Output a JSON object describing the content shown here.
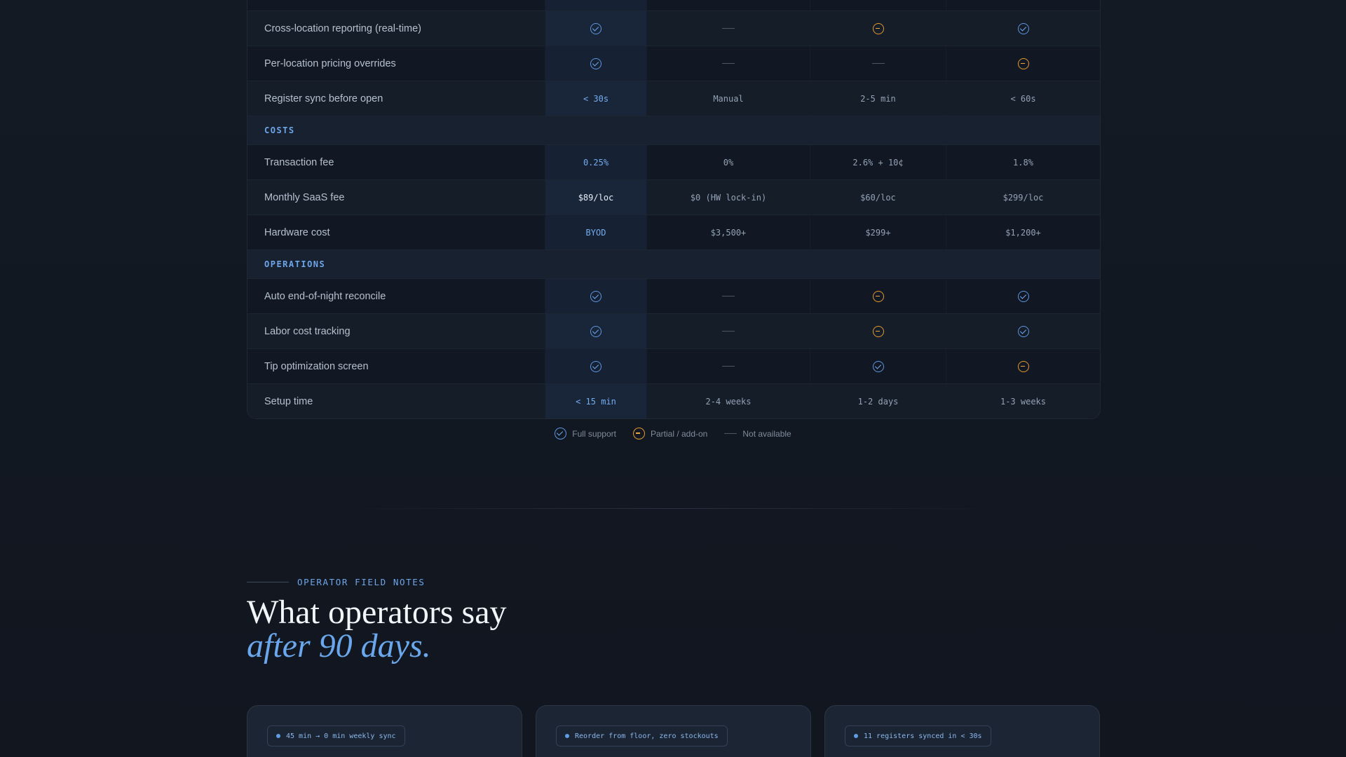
{
  "comparison": {
    "rows_top": [
      {
        "label": "Cross-location reporting (real-time)",
        "cells": [
          "check",
          "dash",
          "partial",
          "check"
        ]
      },
      {
        "label": "Per-location pricing overrides",
        "cells": [
          "check",
          "dash",
          "dash",
          "partial"
        ]
      },
      {
        "label": "Register sync before open",
        "cells": [
          "< 30s",
          "Manual",
          "2-5 min",
          "< 60s"
        ]
      }
    ],
    "sections": [
      {
        "title": "COSTS",
        "rows": [
          {
            "label": "Transaction fee",
            "cells": [
              "0.25%",
              "0%",
              "2.6% + 10¢",
              "1.8%"
            ]
          },
          {
            "label": "Monthly SaaS fee",
            "cells": [
              "$89/loc",
              "$0 (HW lock-in)",
              "$60/loc",
              "$299/loc"
            ]
          },
          {
            "label": "Hardware cost",
            "cells": [
              "BYOD",
              "$3,500+",
              "$299+",
              "$1,200+"
            ]
          }
        ]
      },
      {
        "title": "OPERATIONS",
        "rows": [
          {
            "label": "Auto end-of-night reconcile",
            "cells": [
              "check",
              "dash",
              "partial",
              "check"
            ]
          },
          {
            "label": "Labor cost tracking",
            "cells": [
              "check",
              "dash",
              "partial",
              "check"
            ]
          },
          {
            "label": "Tip optimization screen",
            "cells": [
              "check",
              "dash",
              "check",
              "partial"
            ]
          },
          {
            "label": "Setup time",
            "cells": [
              "< 15 min",
              "2-4 weeks",
              "1-2 days",
              "1-3 weeks"
            ]
          }
        ]
      }
    ]
  },
  "legend": {
    "full": "Full support",
    "partial": "Partial / add-on",
    "none": "Not available"
  },
  "field_notes": {
    "eyebrow": "OPERATOR FIELD NOTES",
    "headline_line1": "What operators say",
    "headline_line2": "after 90 days."
  },
  "cards": [
    {
      "tag": "45 min → 0 min weekly sync"
    },
    {
      "tag": "Reorder from floor, zero stockouts"
    },
    {
      "tag": "11 registers synced in < 30s"
    }
  ],
  "colors": {
    "accent": "#6ea6ea",
    "partial": "#e39a2f",
    "background": "#121720"
  },
  "icons": {
    "check": "check-circle-icon",
    "partial": "minus-circle-icon",
    "dash": "dash-icon"
  }
}
